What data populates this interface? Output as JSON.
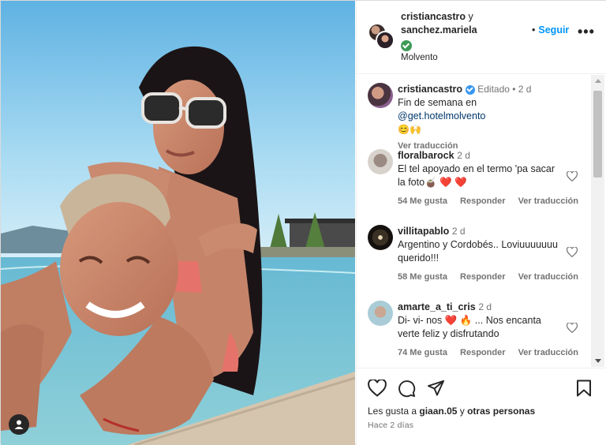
{
  "post": {
    "users": {
      "first": "cristiancastro",
      "connector": "y",
      "second": "sanchez.mariela"
    },
    "location": "Molvento",
    "follow_label": "Seguir",
    "follow_dot": "•",
    "more_label": "•••"
  },
  "caption": {
    "username": "cristiancastro",
    "meta": "Editado • 2 d",
    "text_prefix": "Fin de semana en ",
    "mention": "@get.hotelmolvento",
    "emojis": "😊🙌",
    "translate": "Ver traducción"
  },
  "comments": [
    {
      "username": "floralbarock",
      "time": "2 d",
      "text": "El tel apoyado en el termo 'pa sacar la foto🧉 ❤️ ❤️",
      "likes": "54 Me gusta",
      "reply": "Responder",
      "translate": "Ver traducción"
    },
    {
      "username": "villitapablo",
      "time": "2 d",
      "text": "Argentino y Cordobés.. Loviuuuuuuu querido!!!",
      "likes": "58 Me gusta",
      "reply": "Responder",
      "translate": "Ver traducción"
    },
    {
      "username": "amarte_a_ti_cris",
      "time": "2 d",
      "text": "Di- vi- nos ❤️ 🔥 ... Nos encanta verte feliz y disfrutando",
      "likes": "74 Me gusta",
      "reply": "Responder",
      "translate": "Ver traducción"
    }
  ],
  "footer": {
    "likes_prefix": "Les gusta a ",
    "likes_user": "giaan.05",
    "likes_middle": " y ",
    "likes_others": "otras personas",
    "time": "Hace 2 días"
  },
  "icons": {
    "like": "heart-icon",
    "comment": "comment-icon",
    "share": "share-icon",
    "save": "bookmark-icon",
    "tag": "user-tag-icon"
  },
  "colors": {
    "link": "#0095f6",
    "verified": "#3897f0",
    "secondary_text": "#737373"
  }
}
